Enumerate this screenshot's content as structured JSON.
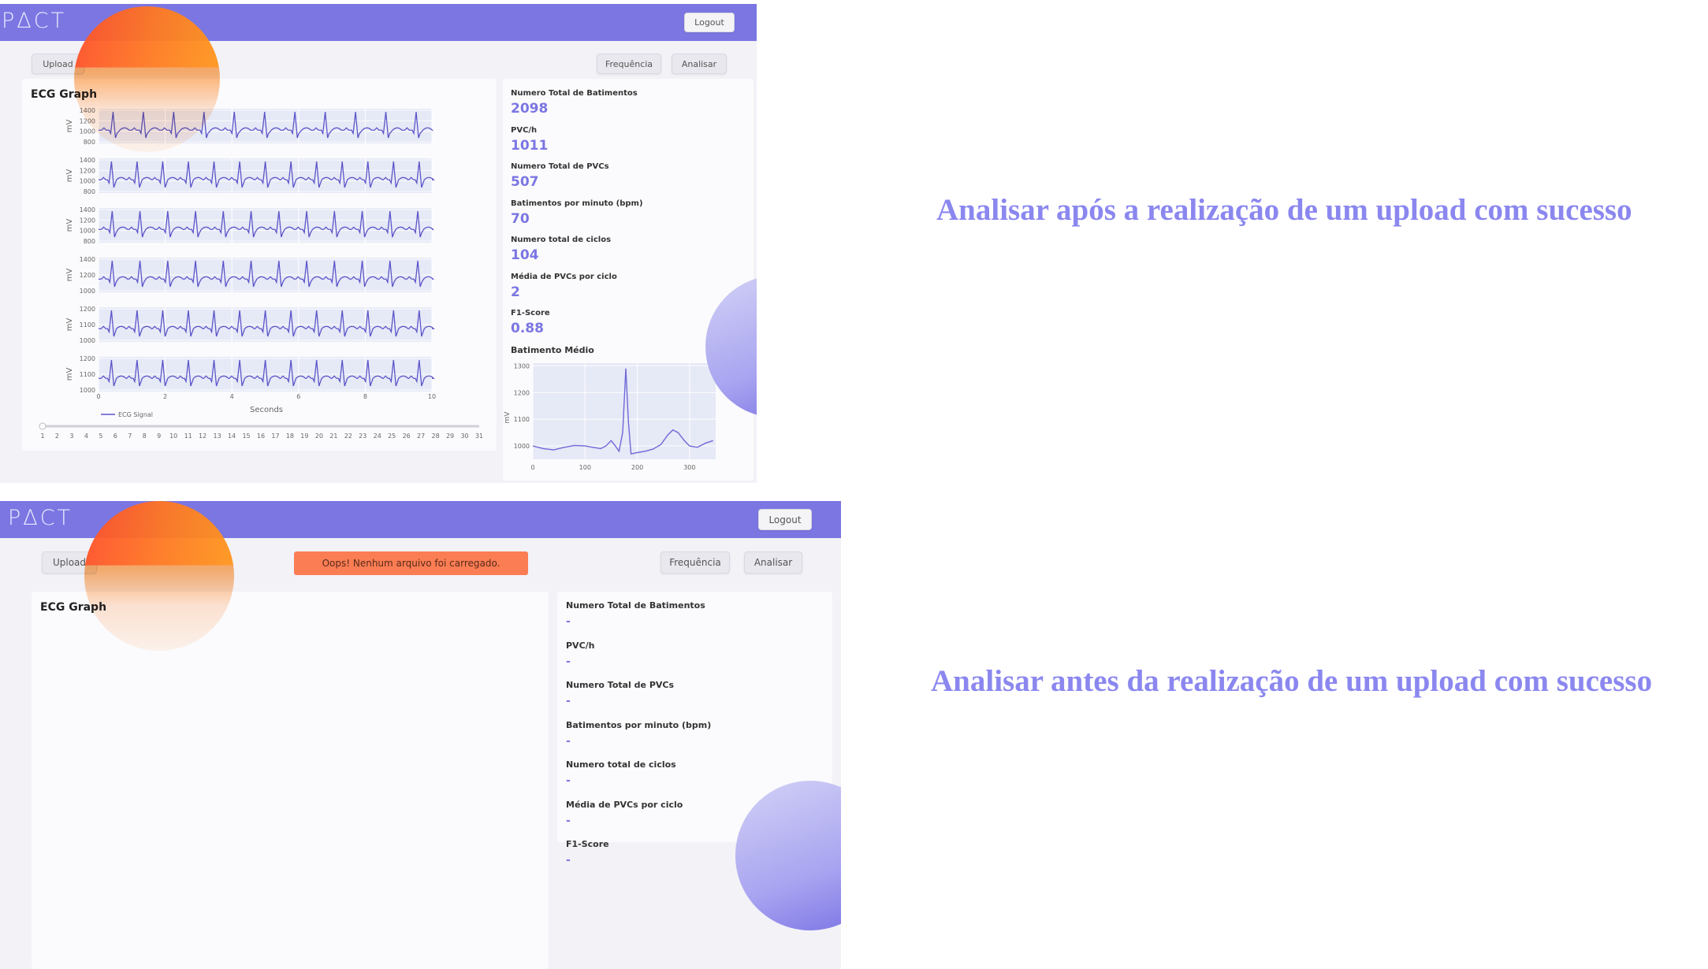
{
  "top": {
    "logo": "PΔCT",
    "logout": "Logout",
    "upload": "Upload",
    "frequencia": "Frequência",
    "analisar": "Analisar",
    "ecg_title": "ECG Graph",
    "stats": [
      {
        "label": "Numero Total de Batimentos",
        "value": "2098"
      },
      {
        "label": "PVC/h",
        "value": "1011"
      },
      {
        "label": "Numero Total de PVCs",
        "value": "507"
      },
      {
        "label": "Batimentos por minuto (bpm)",
        "value": "70"
      },
      {
        "label": "Numero total de ciclos",
        "value": "104"
      },
      {
        "label": "Média de PVCs por ciclo",
        "value": "2"
      },
      {
        "label": "F1-Score",
        "value": "0.88"
      }
    ],
    "avg_title": "Batimento Médio"
  },
  "bottom": {
    "logo": "PΔCT",
    "logout": "Logout",
    "upload": "Upload",
    "frequencia": "Frequência",
    "analisar": "Analisar",
    "alert": "Oops! Nenhum arquivo foi carregado.",
    "ecg_title": "ECG Graph",
    "stats": [
      {
        "label": "Numero Total de Batimentos",
        "value": "-"
      },
      {
        "label": "PVC/h",
        "value": "-"
      },
      {
        "label": "Numero Total de PVCs",
        "value": "-"
      },
      {
        "label": "Batimentos por minuto (bpm)",
        "value": "-"
      },
      {
        "label": "Numero total de ciclos",
        "value": "-"
      },
      {
        "label": "Média de PVCs por ciclo",
        "value": "-"
      },
      {
        "label": "F1-Score",
        "value": "-"
      }
    ]
  },
  "captions": {
    "top": "Analisar após a realização de um upload com sucesso",
    "bottom": "Analisar antes da realização de um upload com sucesso"
  },
  "chart_data": [
    {
      "type": "line",
      "title": "ECG Graph",
      "xlabel": "Seconds",
      "ylabel": "mV",
      "legend": "ECG Signal",
      "xlim": [
        0,
        10
      ],
      "x_ticks": [
        "0",
        "2",
        "4",
        "6",
        "8",
        "10"
      ],
      "rows": [
        {
          "y_ticks": [
            "1400",
            "1200",
            "1000",
            "800"
          ],
          "beats_per_10s": 11
        },
        {
          "y_ticks": [
            "1400",
            "1200",
            "1000",
            "800"
          ],
          "beats_per_10s": 13
        },
        {
          "y_ticks": [
            "1400",
            "1200",
            "1000",
            "800"
          ],
          "beats_per_10s": 12
        },
        {
          "y_ticks": [
            "1400",
            "1200",
            "1000"
          ],
          "beats_per_10s": 12
        },
        {
          "y_ticks": [
            "1200",
            "1100",
            "1000"
          ],
          "beats_per_10s": 13
        },
        {
          "y_ticks": [
            "1200",
            "1100",
            "1000"
          ],
          "beats_per_10s": 13
        }
      ],
      "slider_ticks": [
        "1",
        "2",
        "3",
        "4",
        "5",
        "6",
        "7",
        "8",
        "9",
        "10",
        "11",
        "12",
        "13",
        "14",
        "15",
        "16",
        "17",
        "18",
        "19",
        "20",
        "21",
        "22",
        "23",
        "24",
        "25",
        "26",
        "27",
        "28",
        "29",
        "30",
        "31"
      ]
    },
    {
      "type": "line",
      "title": "Batimento Médio",
      "ylabel": "mV",
      "xlim": [
        0,
        350
      ],
      "ylim": [
        950,
        1310
      ],
      "x_ticks": [
        "0",
        "100",
        "200",
        "300"
      ],
      "y_ticks": [
        "1300",
        "1200",
        "1100",
        "1000"
      ],
      "points": [
        [
          0,
          1000
        ],
        [
          20,
          990
        ],
        [
          40,
          985
        ],
        [
          60,
          995
        ],
        [
          80,
          1002
        ],
        [
          100,
          1000
        ],
        [
          115,
          995
        ],
        [
          130,
          990
        ],
        [
          140,
          1000
        ],
        [
          150,
          1020
        ],
        [
          158,
          1000
        ],
        [
          165,
          980
        ],
        [
          172,
          1050
        ],
        [
          178,
          1290
        ],
        [
          183,
          1090
        ],
        [
          188,
          970
        ],
        [
          200,
          975
        ],
        [
          215,
          980
        ],
        [
          230,
          988
        ],
        [
          245,
          1005
        ],
        [
          258,
          1040
        ],
        [
          268,
          1060
        ],
        [
          278,
          1050
        ],
        [
          290,
          1020
        ],
        [
          300,
          1000
        ],
        [
          315,
          995
        ],
        [
          330,
          1010
        ],
        [
          345,
          1020
        ]
      ]
    }
  ]
}
